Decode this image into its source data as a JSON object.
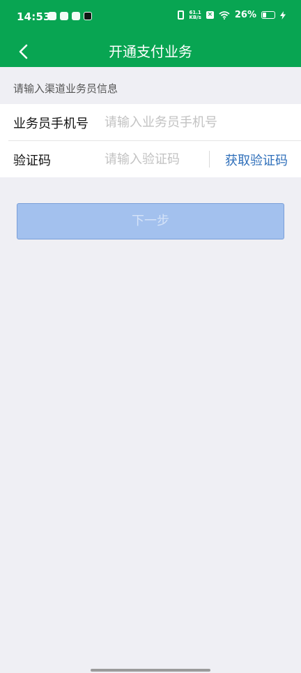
{
  "status_bar": {
    "time": "14:53",
    "net_speed_value": "61.1",
    "net_speed_unit": "KB/s",
    "battery": "26%"
  },
  "header": {
    "title": "开通支付业务"
  },
  "form": {
    "section_label": "请输入渠道业务员信息",
    "phone_label": "业务员手机号",
    "phone_placeholder": "请输入业务员手机号",
    "code_label": "验证码",
    "code_placeholder": "请输入验证码",
    "get_code_label": "获取验证码"
  },
  "actions": {
    "next_label": "下一步"
  },
  "colors": {
    "brand_green": "#08a552",
    "link_blue": "#2f6fba",
    "button_disabled": "#a3c1ee",
    "page_background": "#efeff4"
  }
}
